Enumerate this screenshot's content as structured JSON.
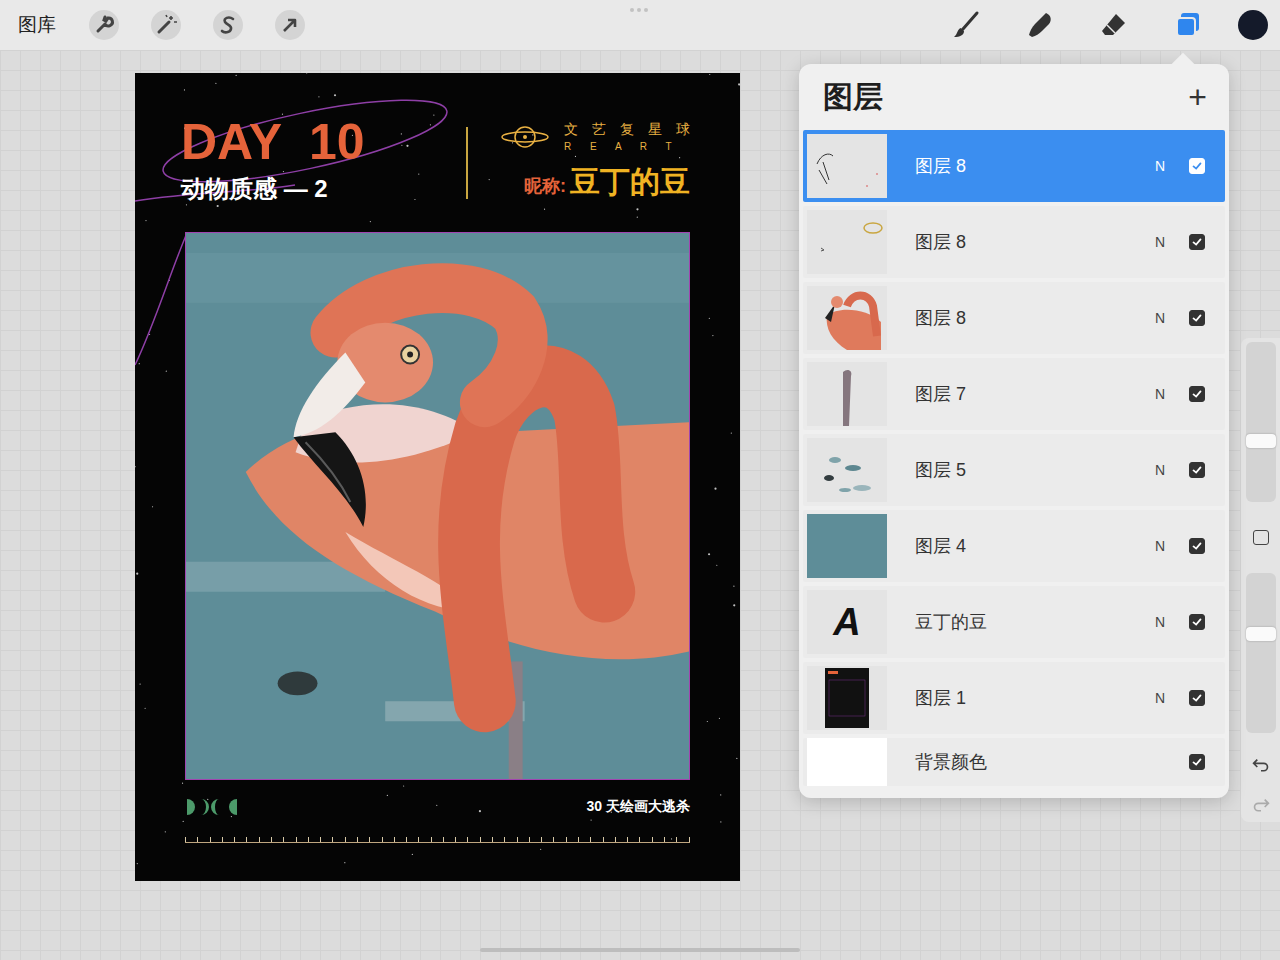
{
  "toolbar": {
    "gallery": "图库"
  },
  "poster": {
    "day": "DAY 10",
    "subtitle": "动物质感 — 2",
    "brand": "文艺复星球",
    "brand_en": "R E A R T",
    "nickname_label": "昵称:",
    "nickname": "豆丁的豆",
    "footer": "30 天绘画大逃杀"
  },
  "layers_panel": {
    "title": "图层",
    "add": "+",
    "layers": [
      {
        "name": "图层 8",
        "blend": "N",
        "visible": true,
        "selected": true,
        "kind": "sketch"
      },
      {
        "name": "图层 8",
        "blend": "N",
        "visible": true,
        "selected": false,
        "kind": "ring"
      },
      {
        "name": "图层 8",
        "blend": "N",
        "visible": true,
        "selected": false,
        "kind": "flamingo"
      },
      {
        "name": "图层 7",
        "blend": "N",
        "visible": true,
        "selected": false,
        "kind": "leg"
      },
      {
        "name": "图层 5",
        "blend": "N",
        "visible": true,
        "selected": false,
        "kind": "spots"
      },
      {
        "name": "图层 4",
        "blend": "N",
        "visible": true,
        "selected": false,
        "kind": "water"
      },
      {
        "name": "豆丁的豆",
        "blend": "N",
        "visible": true,
        "selected": false,
        "kind": "text",
        "glyph": "A"
      },
      {
        "name": "图层 1",
        "blend": "N",
        "visible": true,
        "selected": false,
        "kind": "poster"
      }
    ],
    "background": {
      "name": "背景颜色",
      "visible": true
    }
  },
  "side_sliders": [
    {
      "level": 0.38
    },
    {
      "level": 0.62
    }
  ]
}
